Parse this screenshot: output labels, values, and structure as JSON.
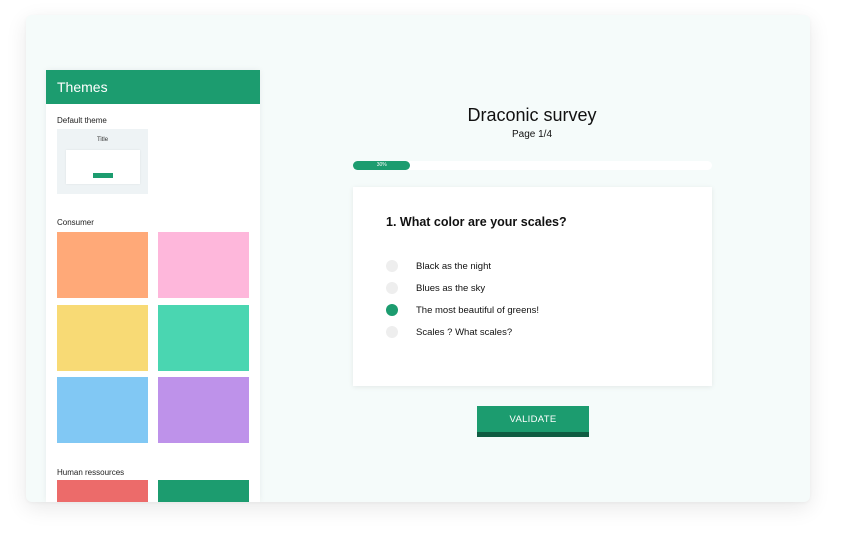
{
  "sidebar": {
    "title": "Themes",
    "default_section": {
      "label": "Default theme",
      "preview_title": "Title"
    },
    "consumer_section": {
      "label": "Consumer",
      "swatches": [
        "#ffa978",
        "#feb7db",
        "#f8da75",
        "#4ad6b1",
        "#81c8f4",
        "#be92ea"
      ]
    },
    "hr_section": {
      "label": "Human ressources",
      "swatches": [
        "#ec6b6a",
        "#1c9c6f"
      ]
    }
  },
  "survey": {
    "title": "Draconic survey",
    "page": "Page 1/4",
    "progress": {
      "percent": 30,
      "label": "30%"
    },
    "question": {
      "number": "1.",
      "text": "What color are your scales?",
      "full": "1.  What color are your scales?",
      "options": [
        {
          "label": "Black as the night",
          "selected": false
        },
        {
          "label": "Blues as the sky",
          "selected": false
        },
        {
          "label": "The most beautiful of greens!",
          "selected": true
        },
        {
          "label": "Scales ? What scales?",
          "selected": false
        }
      ]
    },
    "validate_label": "VALIDATE"
  },
  "colors": {
    "accent": "#1c9c6f",
    "accent_dark": "#0f5c42",
    "window_bg": "#f5fbfa"
  }
}
